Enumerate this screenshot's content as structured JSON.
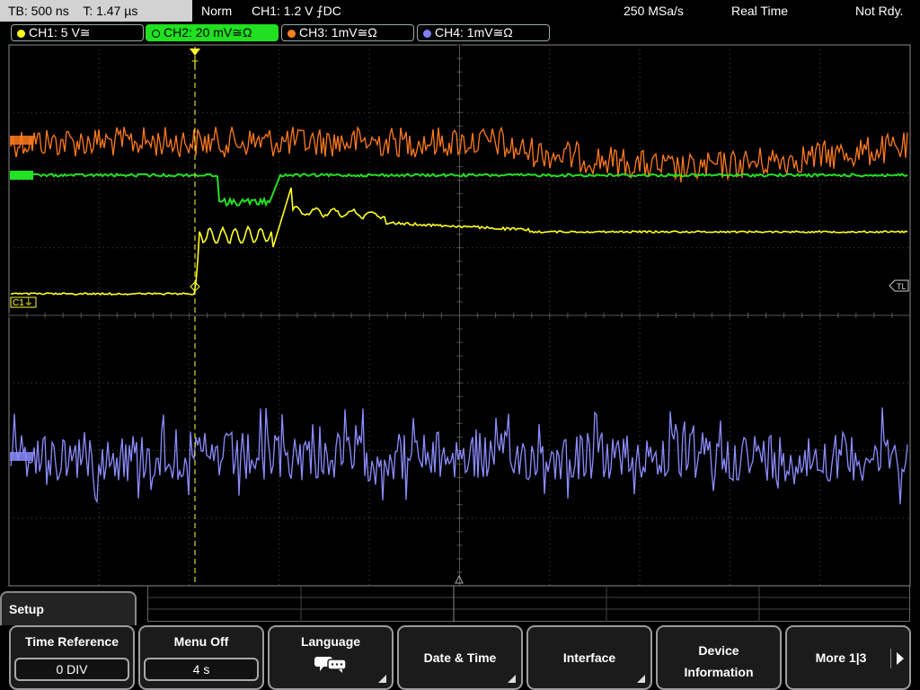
{
  "top_bar": {
    "timebase": "TB: 500 ns",
    "trigger_time": "T: 1.47 µs",
    "trigger_mode": "Norm",
    "trigger_setting": "CH1: 1.2 V ⨍DC",
    "sample_rate": "250 MSa/s",
    "acq_mode": "Real Time",
    "trigger_status": "Not Rdy."
  },
  "channels": [
    {
      "label": "CH1: 5 V≅",
      "color": "#ffff20"
    },
    {
      "label": "CH2: 20 mV≅Ω",
      "color": "#20e020"
    },
    {
      "label": "CH3: 1mV≅Ω",
      "color": "#ff8020"
    },
    {
      "label": "CH4: 1mV≅Ω",
      "color": "#8080ff"
    }
  ],
  "markers": {
    "c1_ground": "C1⏚",
    "trigger_level": "TL",
    "trigger_position": "T"
  },
  "menu": {
    "title": "Setup",
    "softkeys": [
      {
        "label": "Time Reference",
        "value": "0 DIV"
      },
      {
        "label": "Menu Off",
        "value": "4 s"
      },
      {
        "label": "Language",
        "icon": "speech-bubbles-icon"
      },
      {
        "label": "Date & Time"
      },
      {
        "label": "Interface"
      },
      {
        "label": "Device",
        "label2": "Information"
      },
      {
        "label": "More 1|3"
      }
    ]
  }
}
